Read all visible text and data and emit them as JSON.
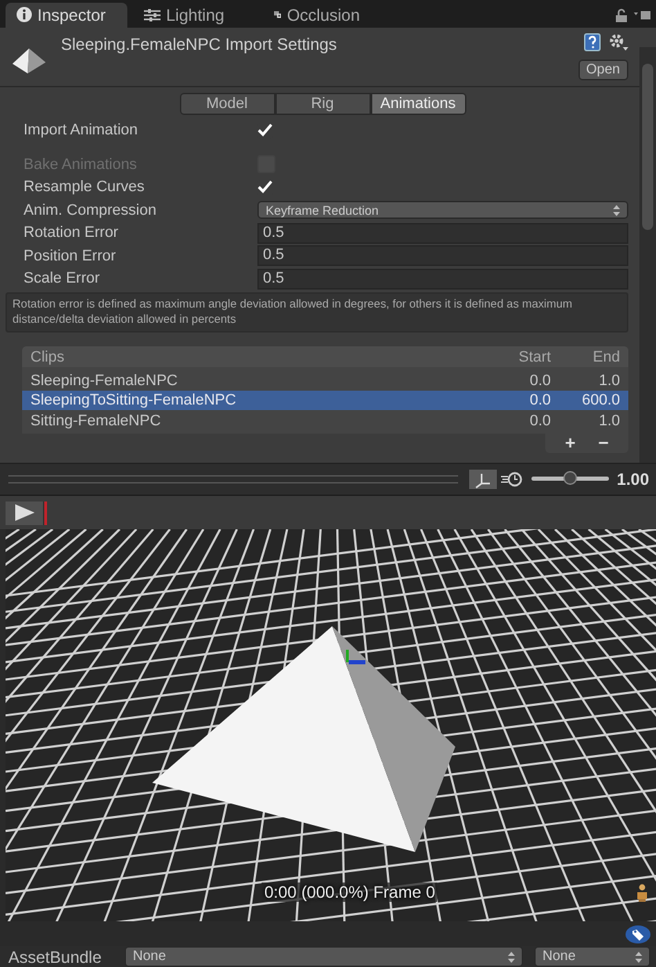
{
  "tabs": [
    {
      "label": "Inspector",
      "selected": true
    },
    {
      "label": "Lighting",
      "selected": false
    },
    {
      "label": "Occlusion",
      "selected": false
    }
  ],
  "header": {
    "title": "Sleeping.FemaleNPC Import Settings",
    "open_button": "Open"
  },
  "sections": [
    {
      "label": "Model",
      "selected": false
    },
    {
      "label": "Rig",
      "selected": false
    },
    {
      "label": "Animations",
      "selected": true
    }
  ],
  "fields": [
    {
      "kind": "checkbox",
      "label": "Import Animation",
      "checked": true,
      "disabled": false
    },
    {
      "kind": "checkbox",
      "label": "Bake Animations",
      "checked": false,
      "disabled": true
    },
    {
      "kind": "checkbox",
      "label": "Resample Curves",
      "checked": true,
      "disabled": false
    },
    {
      "kind": "dropdown",
      "label": "Anim. Compression",
      "value": "Keyframe Reduction"
    },
    {
      "kind": "number",
      "label": "Rotation Error",
      "value": "0.5"
    },
    {
      "kind": "number",
      "label": "Position Error",
      "value": "0.5"
    },
    {
      "kind": "number",
      "label": "Scale Error",
      "value": "0.5"
    }
  ],
  "help_text": "Rotation error is defined as maximum angle deviation allowed in degrees, for others it is defined as maximum distance/delta deviation allowed in percents",
  "clips": {
    "columns": [
      "Clips",
      "Start",
      "End"
    ],
    "rows": [
      {
        "name": "Sleeping-FemaleNPC",
        "start": "0.0",
        "end": "1.0",
        "selected": false
      },
      {
        "name": "SleepingToSitting-FemaleNPC",
        "start": "0.0",
        "end": "600.0",
        "selected": true
      },
      {
        "name": "Sitting-FemaleNPC",
        "start": "0.0",
        "end": "1.0",
        "selected": false
      }
    ],
    "add_button": "+",
    "remove_button": "−"
  },
  "preview": {
    "speed": {
      "level": 0.5,
      "reading": "1.00"
    },
    "status": "0:00 (000.0%) Frame 0"
  },
  "asset_bundle": {
    "label": "AssetBundle",
    "name": "None",
    "variant": "None"
  }
}
